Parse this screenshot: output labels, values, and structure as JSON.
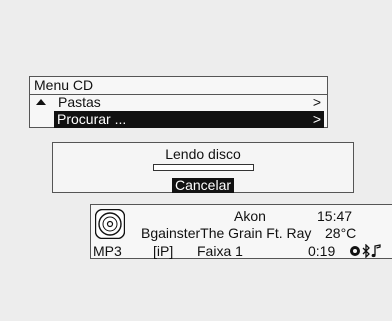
{
  "menu": {
    "title": "Menu CD",
    "items": [
      {
        "label": "Pastas",
        "arrow": ">",
        "selected": false
      },
      {
        "label": "Procurar ...",
        "arrow": ">",
        "selected": true
      }
    ]
  },
  "dialog": {
    "title": "Lendo disco",
    "progress": 0.0,
    "cancel_label": "Cancelar"
  },
  "status": {
    "artist": "Akon",
    "track": "BgainsterThe Grain Ft. Ray",
    "format": "MP3",
    "source": "[iP]",
    "track_number": "Faixa 1",
    "clock": "15:47",
    "temperature": "28°C",
    "elapsed": "0:19",
    "icons": [
      "disc-icon",
      "record-icon",
      "bluetooth-icon",
      "music-note-icon"
    ]
  },
  "colors": {
    "background": "#ededed",
    "highlight": "#111111",
    "highlight_text": "#ffffff"
  }
}
